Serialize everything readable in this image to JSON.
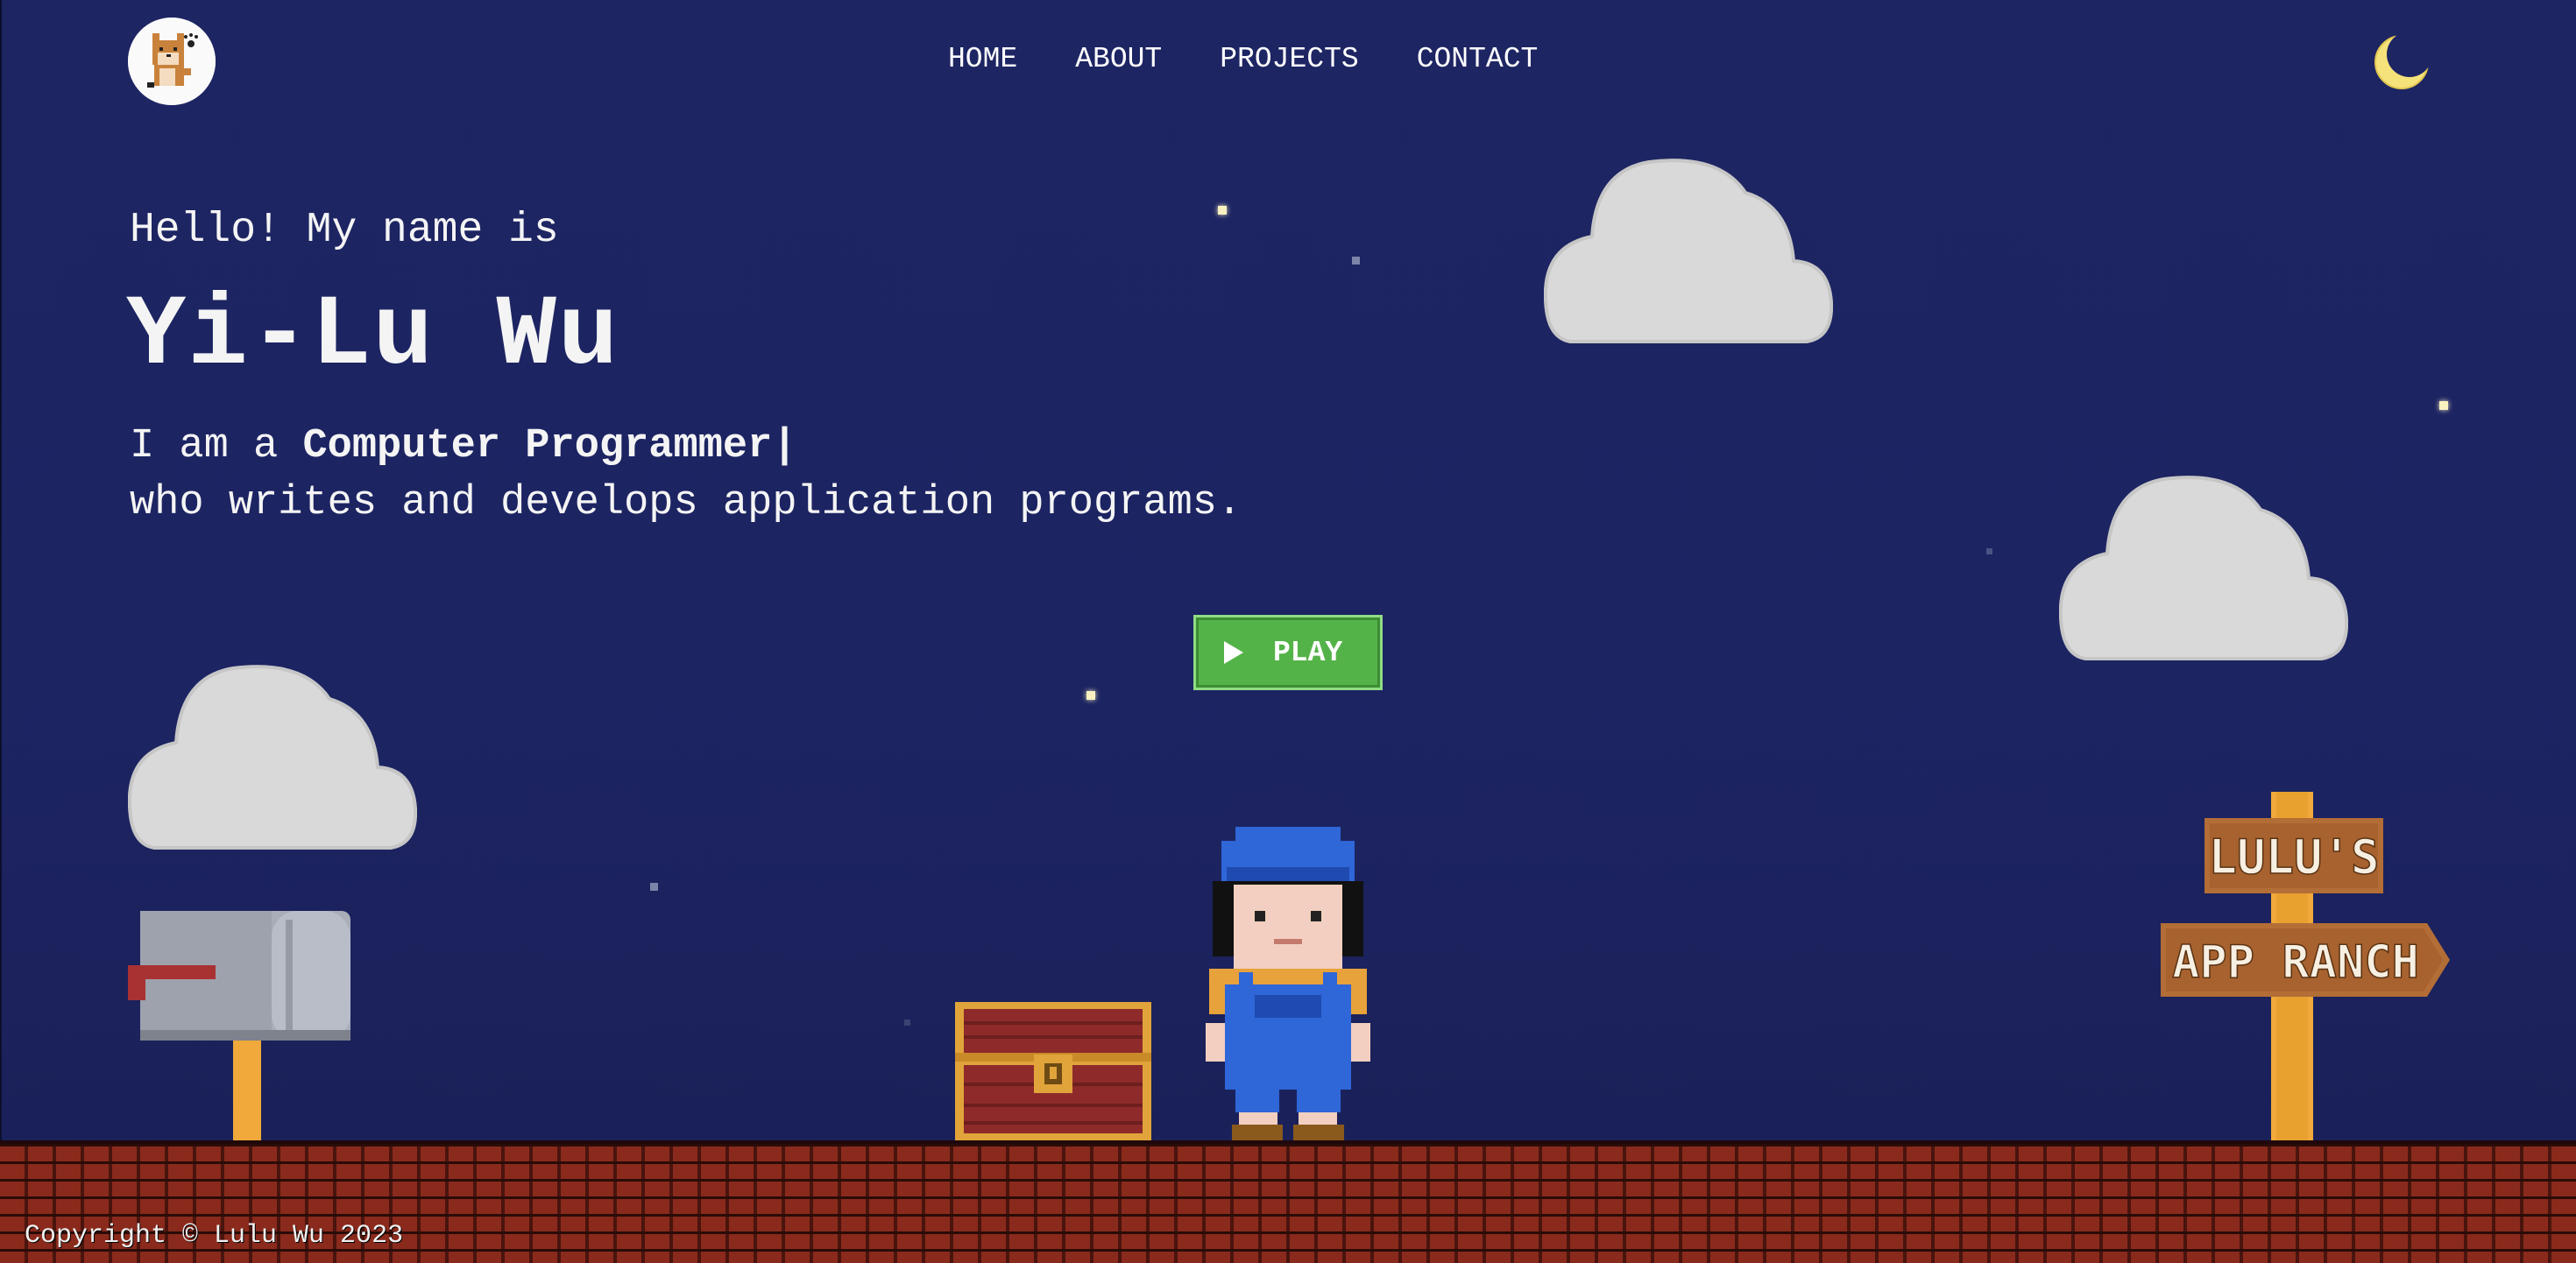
{
  "header": {
    "logo_alt": "shiba dog logo",
    "nav": [
      {
        "label": "HOME"
      },
      {
        "label": "ABOUT"
      },
      {
        "label": "PROJECTS"
      },
      {
        "label": "CONTACT"
      }
    ],
    "theme_toggle_icon": "moon-icon"
  },
  "hero": {
    "greeting": "Hello! My name is",
    "name": "Yi-Lu Wu",
    "role_prefix": "I am a ",
    "role": "Computer Programmer|",
    "description": "who writes and develops application programs."
  },
  "play_button": {
    "label": "PLAY",
    "icon": "play-icon"
  },
  "scene": {
    "signpost_top": "LULU'S",
    "signpost_bottom": "APP RANCH"
  },
  "footer": {
    "copyright": "Copyright © Lulu Wu 2023"
  },
  "colors": {
    "background": "#1e2563",
    "play_button": "#54b348",
    "moon": "#f6e27a",
    "brick": "#8a2a1c"
  }
}
